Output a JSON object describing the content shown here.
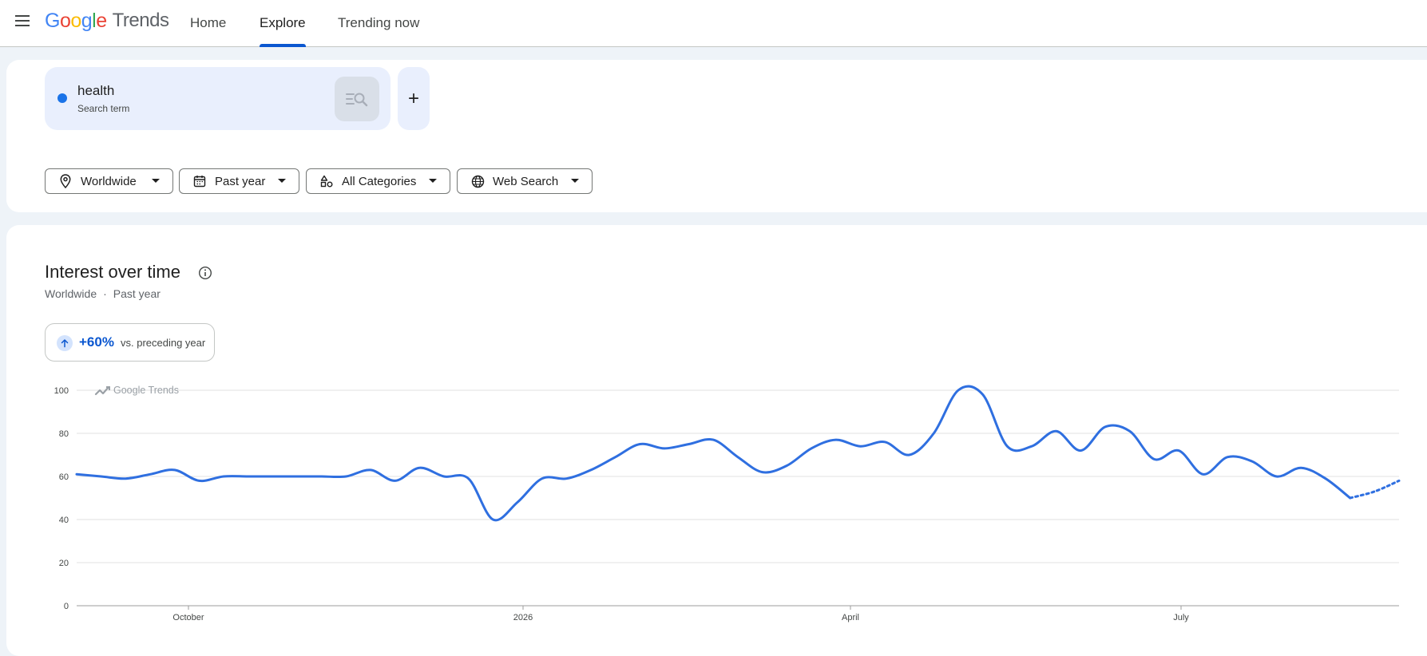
{
  "header": {
    "logo": {
      "letters": [
        "G",
        "o",
        "o",
        "g",
        "l",
        "e"
      ],
      "product": "Trends"
    },
    "nav": {
      "home": "Home",
      "explore": "Explore",
      "trending_now": "Trending now"
    },
    "icons": {
      "menu": "hamburger-menu-icon"
    }
  },
  "search": {
    "term": "health",
    "term_type": "Search term",
    "series_color": "#1a73e8",
    "add_label": "+"
  },
  "filters": {
    "location": "Worldwide",
    "time": "Past year",
    "category": "All Categories",
    "property": "Web Search"
  },
  "interest": {
    "title": "Interest over time",
    "subtitle_location": "Worldwide",
    "subtitle_separator": "·",
    "subtitle_time": "Past year",
    "change": "+60%",
    "change_note": "vs. preceding year",
    "watermark": "Google Trends"
  },
  "colors": {
    "accent": "#0b57d0",
    "line": "#2f6fe0",
    "grid": "#e0e0e0"
  },
  "chart_data": {
    "type": "line",
    "x_ticks": [
      "October",
      "2026",
      "April",
      "July"
    ],
    "y_ticks": [
      0,
      20,
      40,
      60,
      80,
      100
    ],
    "ylim": [
      0,
      100
    ],
    "grid": true,
    "series": [
      {
        "values": [
          61,
          60,
          59,
          61,
          63,
          58,
          60,
          60,
          60,
          60,
          60,
          60,
          63,
          58,
          64,
          60,
          59,
          40,
          48,
          59,
          59,
          63,
          69,
          75,
          73,
          75,
          77,
          69,
          62,
          65,
          73,
          77,
          74,
          76,
          70,
          80,
          100,
          98,
          74,
          74,
          81,
          72,
          83,
          81,
          68,
          72,
          61,
          69,
          67,
          60,
          64,
          59,
          50
        ],
        "projected_tail": [
          50,
          53,
          58
        ]
      }
    ]
  }
}
